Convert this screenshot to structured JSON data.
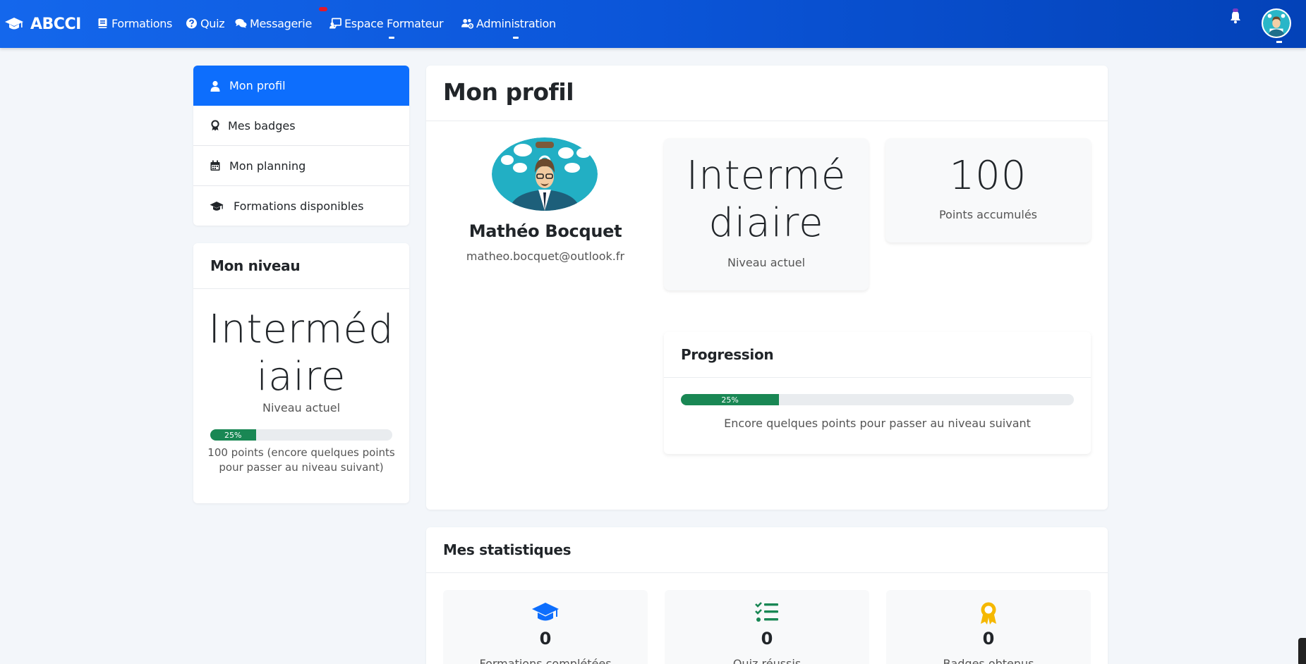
{
  "brand": {
    "name": "ABCCI"
  },
  "nav": {
    "formations": "Formations",
    "quiz": "Quiz",
    "messagerie": "Messagerie",
    "espace_formateur": "Espace Formateur",
    "administration": "Administration"
  },
  "sidebar": {
    "items": [
      {
        "label": "Mon profil",
        "icon": "user-icon"
      },
      {
        "label": "Mes badges",
        "icon": "award-icon"
      },
      {
        "label": "Mon planning",
        "icon": "calendar-icon"
      },
      {
        "label": "Formations disponibles",
        "icon": "graduation-cap-icon"
      }
    ]
  },
  "level_card": {
    "title": "Mon niveau",
    "level_line1": "Interméd",
    "level_line2": "iaire",
    "level_caption": "Niveau actuel",
    "progress_percent": 25,
    "progress_label": "25%",
    "points_note_line1": "100 points (encore quelques points",
    "points_note_line2": "pour passer au niveau suivant)"
  },
  "profile": {
    "title": "Mon profil",
    "name": "Mathéo Bocquet",
    "email": "matheo.bocquet@outlook.fr",
    "level_line1": "Intermé",
    "level_line2": "diaire",
    "level_caption": "Niveau actuel",
    "points": "100",
    "points_caption": "Points accumulés"
  },
  "progression": {
    "title": "Progression",
    "percent": 25,
    "label": "25%",
    "note": "Encore quelques points pour passer au niveau suivant"
  },
  "stats": {
    "title": "Mes statistiques",
    "tiles": [
      {
        "value": "0",
        "label": "Formations complétées",
        "icon": "graduation-cap-icon",
        "color": "#0d6efd"
      },
      {
        "value": "0",
        "label": "Quiz réussis",
        "icon": "checklist-icon",
        "color": "#198754"
      },
      {
        "value": "0",
        "label": "Badges obtenus",
        "icon": "award-icon",
        "color": "#f5b800"
      }
    ]
  },
  "colors": {
    "primary": "#0d6efd",
    "success": "#198754",
    "warning": "#f5b800",
    "navbar": "#0b55d8"
  }
}
